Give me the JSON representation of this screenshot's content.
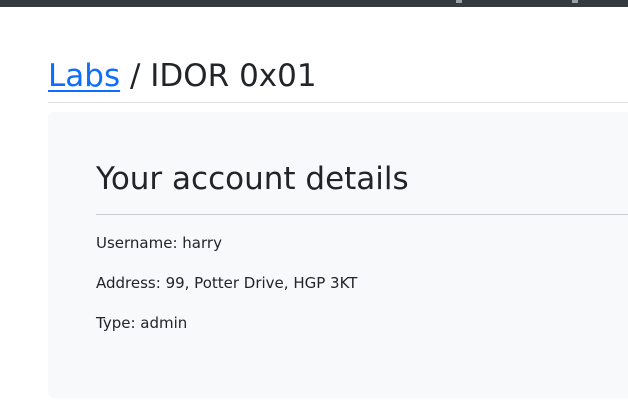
{
  "breadcrumb": {
    "link": "Labs",
    "separator": " / ",
    "current": "IDOR 0x01"
  },
  "card": {
    "title": "Your account details",
    "username_label": "Username: ",
    "username": "harry",
    "address_label": "Address: ",
    "address": "99, Potter Drive, HGP 3KT",
    "type_label": "Type: ",
    "type": "admin"
  },
  "colors": {
    "link": "#0d6efd",
    "navbar": "#343a40",
    "card_background": "#f8f9fa"
  }
}
